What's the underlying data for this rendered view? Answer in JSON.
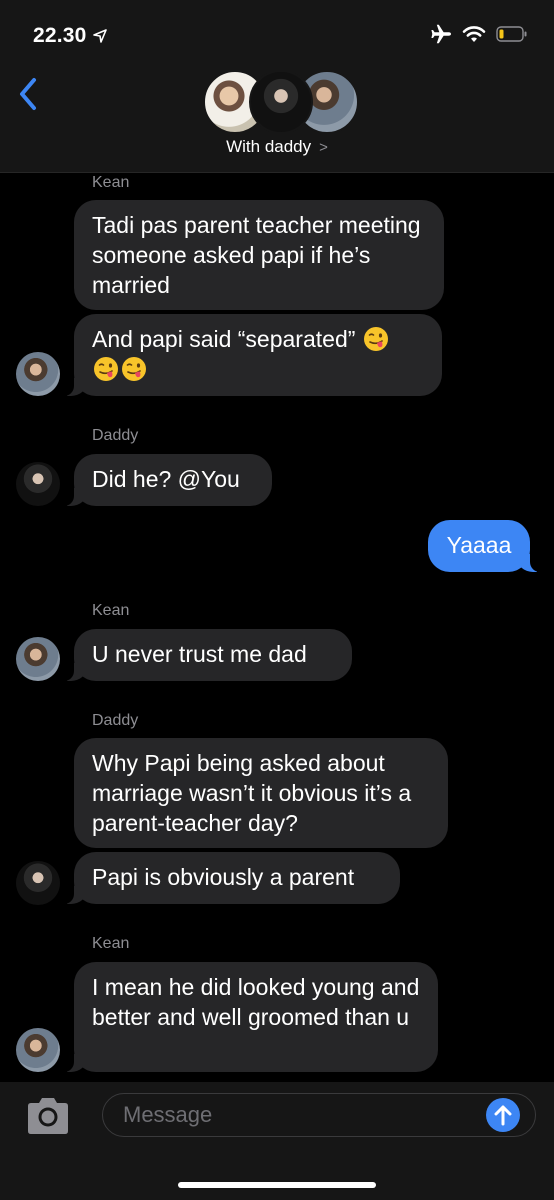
{
  "status_bar": {
    "time": "22.30"
  },
  "header": {
    "group_name": "With daddy",
    "chevron": ">"
  },
  "messages": [
    {
      "sender": "Kean",
      "text": "Tadi pas parent teacher meeting someone asked papi if he’s married"
    },
    {
      "text": "And papi said “separated”"
    },
    {
      "sender": "Daddy",
      "text": "Did he? @You"
    },
    {
      "text": "Yaaaa",
      "outgoing": true
    },
    {
      "sender": "Kean",
      "text": "U never trust me dad"
    },
    {
      "sender": "Daddy",
      "text": "Why Papi being asked about marriage wasn’t it obvious it’s a parent-teacher day?"
    },
    {
      "text": "Papi is obviously a parent"
    },
    {
      "sender": "Kean",
      "text": "I mean he did looked young and better and well groomed than u"
    }
  ],
  "input": {
    "placeholder": "Message"
  },
  "colors": {
    "outgoing_bubble": "#3d86f4",
    "incoming_bubble": "#262628",
    "background": "#000000"
  }
}
